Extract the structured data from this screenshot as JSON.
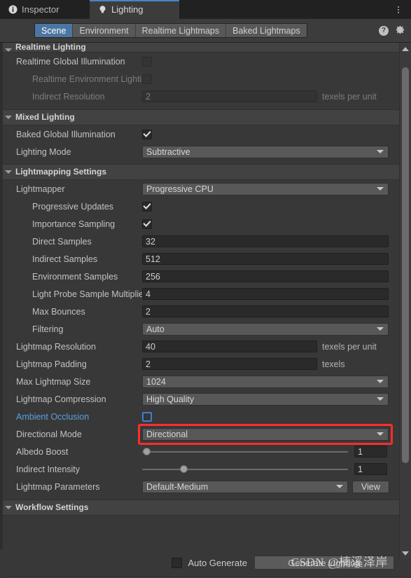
{
  "window": {
    "tabs": [
      {
        "label": "Inspector",
        "icon": "info-icon",
        "active": false
      },
      {
        "label": "Lighting",
        "icon": "lightbulb-icon",
        "active": true
      }
    ],
    "menu_icon": "kebab-menu-icon"
  },
  "toolbar": {
    "segments": [
      {
        "label": "Scene",
        "active": true
      },
      {
        "label": "Environment",
        "active": false
      },
      {
        "label": "Realtime Lightmaps",
        "active": false
      },
      {
        "label": "Baked Lightmaps",
        "active": false
      }
    ],
    "help_icon": "help-icon",
    "settings_icon": "gear-icon",
    "active_accent": "#4b76a3"
  },
  "sections": {
    "realtime_lighting": {
      "title": "Realtime Lighting",
      "rows": {
        "realtime_gi": {
          "label": "Realtime Global Illumination",
          "checked": false
        },
        "realtime_env_lighting": {
          "label": "Realtime Environment Lighting",
          "checked": false
        },
        "indirect_resolution": {
          "label": "Indirect Resolution",
          "value": "2",
          "suffix": "texels per unit"
        }
      }
    },
    "mixed_lighting": {
      "title": "Mixed Lighting",
      "rows": {
        "baked_gi": {
          "label": "Baked Global Illumination",
          "checked": true
        },
        "lighting_mode": {
          "label": "Lighting Mode",
          "value": "Subtractive"
        }
      }
    },
    "lightmapping_settings": {
      "title": "Lightmapping Settings",
      "rows": {
        "lightmapper": {
          "label": "Lightmapper",
          "value": "Progressive CPU"
        },
        "progressive_updates": {
          "label": "Progressive Updates",
          "checked": true
        },
        "importance_sampling": {
          "label": "Importance Sampling",
          "checked": true
        },
        "direct_samples": {
          "label": "Direct Samples",
          "value": "32"
        },
        "indirect_samples": {
          "label": "Indirect Samples",
          "value": "512"
        },
        "environment_samples": {
          "label": "Environment Samples",
          "value": "256"
        },
        "light_probe_sample_multiplier": {
          "label": "Light Probe Sample Multiplier",
          "value": "4"
        },
        "max_bounces": {
          "label": "Max Bounces",
          "value": "2"
        },
        "filtering": {
          "label": "Filtering",
          "value": "Auto"
        },
        "lightmap_resolution": {
          "label": "Lightmap Resolution",
          "value": "40",
          "suffix": "texels per unit"
        },
        "lightmap_padding": {
          "label": "Lightmap Padding",
          "value": "2",
          "suffix": "texels"
        },
        "max_lightmap_size": {
          "label": "Max Lightmap Size",
          "value": "1024"
        },
        "lightmap_compression": {
          "label": "Lightmap Compression",
          "value": "High Quality"
        },
        "ambient_occlusion": {
          "label": "Ambient Occlusion",
          "checked": false,
          "color": "#5a9fe0"
        },
        "directional_mode": {
          "label": "Directional Mode",
          "value": "Directional",
          "highlighted": true,
          "highlight_color": "#ff2d2d"
        },
        "albedo_boost": {
          "label": "Albedo Boost",
          "value": "1",
          "slider_percent": 2
        },
        "indirect_intensity": {
          "label": "Indirect Intensity",
          "value": "1",
          "slider_percent": 20
        },
        "lightmap_parameters": {
          "label": "Lightmap Parameters",
          "value": "Default-Medium",
          "button": "View"
        }
      }
    },
    "workflow_settings": {
      "title": "Workflow Settings"
    }
  },
  "bottom_bar": {
    "auto_generate_label": "Auto Generate",
    "auto_generate_checked": false,
    "generate_button": "Generate Lighting"
  },
  "watermark": {
    "text": "CSDN @楠溪泽岸"
  }
}
